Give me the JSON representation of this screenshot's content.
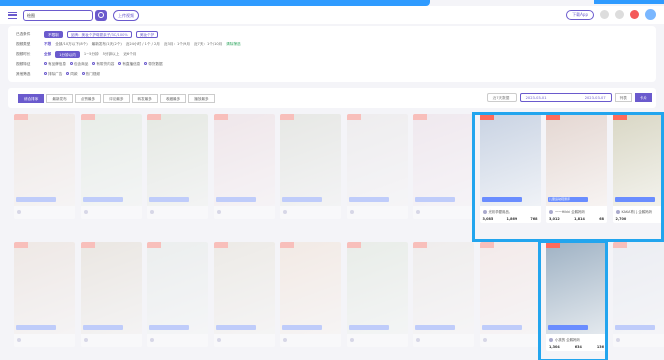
{
  "header": {
    "search_value": "绘图",
    "upload_label": "上传视频",
    "right_button": "下载App",
    "badge": "New"
  },
  "filters": {
    "rows": [
      {
        "label": "已选条件",
        "chips": [
          "不限制",
          "品牌：美妆个护母婴亲子/3C/100%",
          "美妆个护"
        ],
        "extra": ""
      },
      {
        "label": "视频类型",
        "options": [
          "不限",
          "全部/10万以下(8个)",
          "最新发布/1天(2个)",
          "近24小时 / 1个 / 2月",
          "近3月：1个/9月",
          "近7天：1个/10月"
        ],
        "extra": "清除筛选"
      },
      {
        "label": "视频时长",
        "options": [
          "全部",
          "1分钟以内",
          "1~5分钟",
          "5分钟以上",
          "近6个月"
        ],
        "extra": ""
      },
      {
        "label": "视频特征",
        "options": [
          "有品牌信息",
          "包含商品",
          "有带货内容",
          "有直播信息",
          "带货数据"
        ],
        "extra": ""
      },
      {
        "label": "其他筛选",
        "options": [
          "排除广告",
          "同款",
          "热门视频"
        ],
        "extra": ""
      }
    ]
  },
  "toolbar": {
    "tabs": [
      "综合排序",
      "最新发布",
      "点赞最多",
      "评论最多",
      "转发最多",
      "收藏最多",
      "播放最多"
    ],
    "sort_select": "近7天数据",
    "date_from": "2023-03-01",
    "date_to": "2023-03-07",
    "segments": [
      "列表",
      "卡片"
    ]
  },
  "cards": [
    {
      "title": "",
      "author": "",
      "tag": "",
      "stat1": "",
      "stat2": "",
      "stat3": "",
      "color": "#e9d8c9",
      "faded": true
    },
    {
      "title": "",
      "author": "",
      "tag": "",
      "stat1": "",
      "stat2": "",
      "stat3": "",
      "color": "#d6e3cf",
      "faded": true
    },
    {
      "title": "",
      "author": "",
      "tag": "",
      "stat1": "",
      "stat2": "",
      "stat3": "",
      "color": "#cfd8c2",
      "faded": true
    },
    {
      "title": "",
      "author": "",
      "tag": "",
      "stat1": "",
      "stat2": "",
      "stat3": "",
      "color": "#ead2d5",
      "faded": true
    },
    {
      "title": "",
      "author": "",
      "tag": "",
      "stat1": "",
      "stat2": "",
      "stat3": "",
      "color": "#d2d5c7",
      "faded": true
    },
    {
      "title": "",
      "author": "",
      "tag": "",
      "stat1": "",
      "stat2": "",
      "stat3": "",
      "color": "#e6e2e0",
      "faded": true
    },
    {
      "title": "",
      "author": "",
      "tag": "",
      "stat1": "",
      "stat2": "",
      "stat3": "",
      "color": "#ead7e0",
      "faded": true
    },
    {
      "title": "",
      "author": "光彩孕婴用品，",
      "tag": "",
      "stat1": "3,085",
      "stat2": "1,869",
      "stat3": "768",
      "color": "#c9d3e3",
      "faded": false
    },
    {
      "title": "儿童运动鞋测评",
      "author": "一一Hikki 企鹅妈妈",
      "tag": "",
      "stat1": "3,012",
      "stat2": "1,814",
      "stat3": "68",
      "color": "#e4d7d2",
      "faded": false
    },
    {
      "title": "",
      "author": "KAKA育儿 企鹅妈妈",
      "tag": "",
      "stat1": "2,700",
      "stat2": "",
      "stat3": "",
      "color": "#d9d7c5",
      "faded": false
    },
    {
      "title": "",
      "author": "",
      "tag": "",
      "stat1": "",
      "stat2": "",
      "stat3": "",
      "color": "#e6d6c8",
      "faded": true
    },
    {
      "title": "",
      "author": "",
      "tag": "",
      "stat1": "",
      "stat2": "",
      "stat3": "",
      "color": "#dcd2c0",
      "faded": true
    },
    {
      "title": "",
      "author": "",
      "tag": "",
      "stat1": "",
      "stat2": "",
      "stat3": "",
      "color": "#dfe6df",
      "faded": true
    },
    {
      "title": "",
      "author": "",
      "tag": "",
      "stat1": "",
      "stat2": "",
      "stat3": "",
      "color": "#e2dccb",
      "faded": true
    },
    {
      "title": "",
      "author": "",
      "tag": "",
      "stat1": "",
      "stat2": "",
      "stat3": "",
      "color": "#f0dbc7",
      "faded": true
    },
    {
      "title": "",
      "author": "",
      "tag": "",
      "stat1": "",
      "stat2": "",
      "stat3": "",
      "color": "#d7e2d0",
      "faded": true
    },
    {
      "title": "",
      "author": "",
      "tag": "",
      "stat1": "",
      "stat2": "",
      "stat3": "",
      "color": "#e8e2da",
      "faded": true
    },
    {
      "title": "",
      "author": "",
      "tag": "",
      "stat1": "",
      "stat2": "",
      "stat3": "",
      "color": "#f2dcd4",
      "faded": true
    },
    {
      "title": "",
      "author": "小孩的 企鹅妈妈",
      "tag": "",
      "stat1": "1,304",
      "stat2": "634",
      "stat3": "136",
      "color": "#9fb2c4",
      "faded": false
    },
    {
      "title": "",
      "author": "",
      "tag": "",
      "stat1": "",
      "stat2": "",
      "stat3": "",
      "color": "#dfe3ea",
      "faded": true
    }
  ]
}
